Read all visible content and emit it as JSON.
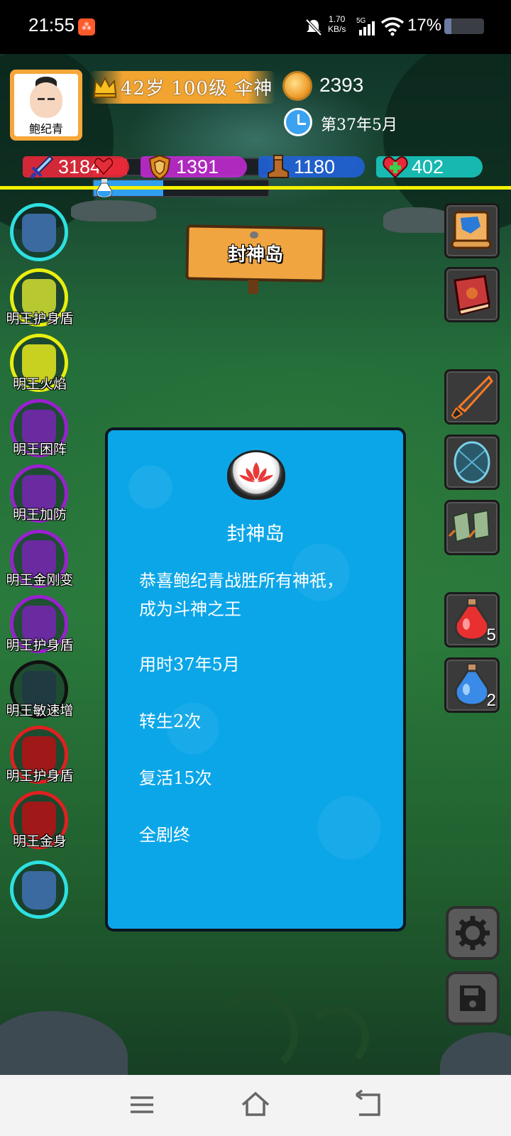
{
  "status_bar": {
    "time": "21:55",
    "net_speed_value": "1.70",
    "net_speed_unit": "KB/s",
    "network": "5G",
    "battery": "17%",
    "battery_level": 0.17
  },
  "player": {
    "name": "鲍纪青",
    "level_line": "42岁 100级 伞神",
    "hp_fraction": 0.19,
    "mp_fraction": 0.4,
    "gold": "2393",
    "date": "第37年5月"
  },
  "stats": [
    {
      "value": "3184",
      "icon": "sword-icon",
      "color": "#e8283a"
    },
    {
      "value": "1391",
      "icon": "shield-icon",
      "color": "#c02ad0"
    },
    {
      "value": "1180",
      "icon": "boot-icon",
      "color": "#2060d8"
    },
    {
      "value": "402",
      "icon": "heart-plus-icon",
      "color": "#18c8c0"
    }
  ],
  "location_sign": "封神岛",
  "buffs": [
    {
      "label": "",
      "ring": "#2ee0e0",
      "fill": "#3a6aa0"
    },
    {
      "label": "明王护身盾",
      "ring": "#e8ee10",
      "fill": "#b8c830"
    },
    {
      "label": "明王火焰",
      "ring": "#e8ee10",
      "fill": "#c8d020"
    },
    {
      "label": "明王困阵",
      "ring": "#9a20d0",
      "fill": "#6a2aa0"
    },
    {
      "label": "明王加防",
      "ring": "#9a20d0",
      "fill": "#6a2aa0"
    },
    {
      "label": "明王金刚变",
      "ring": "#9a20d0",
      "fill": "#6a2aa0"
    },
    {
      "label": "明王护身盾",
      "ring": "#9a20d0",
      "fill": "#6a2aa0"
    },
    {
      "label": "明王敏速增",
      "ring": "#111111",
      "fill": "#1f3a40"
    },
    {
      "label": "明王护身盾",
      "ring": "#e02020",
      "fill": "#a01818"
    },
    {
      "label": "明王金身",
      "ring": "#e02020",
      "fill": "#a01818"
    },
    {
      "label": "",
      "ring": "#2ee0e0",
      "fill": "#3a6aa0"
    }
  ],
  "side_items": [
    {
      "name": "map-scroll",
      "count": ""
    },
    {
      "name": "spell-book",
      "count": ""
    },
    {
      "name": "weapon-slot",
      "count": ""
    },
    {
      "name": "armor-slot",
      "count": ""
    },
    {
      "name": "boots-slot",
      "count": ""
    },
    {
      "name": "red-potion",
      "count": "5"
    },
    {
      "name": "blue-potion",
      "count": "2"
    }
  ],
  "dialog": {
    "icon": "lotus-icon",
    "title": "封神岛",
    "message_line1": "恭喜鲍纪青战胜所有神祇，",
    "message_line2": "成为斗神之王",
    "time_used": "用时37年5月",
    "rebirths": "转生2次",
    "revives": "复活15次",
    "ending": "全剧终"
  }
}
